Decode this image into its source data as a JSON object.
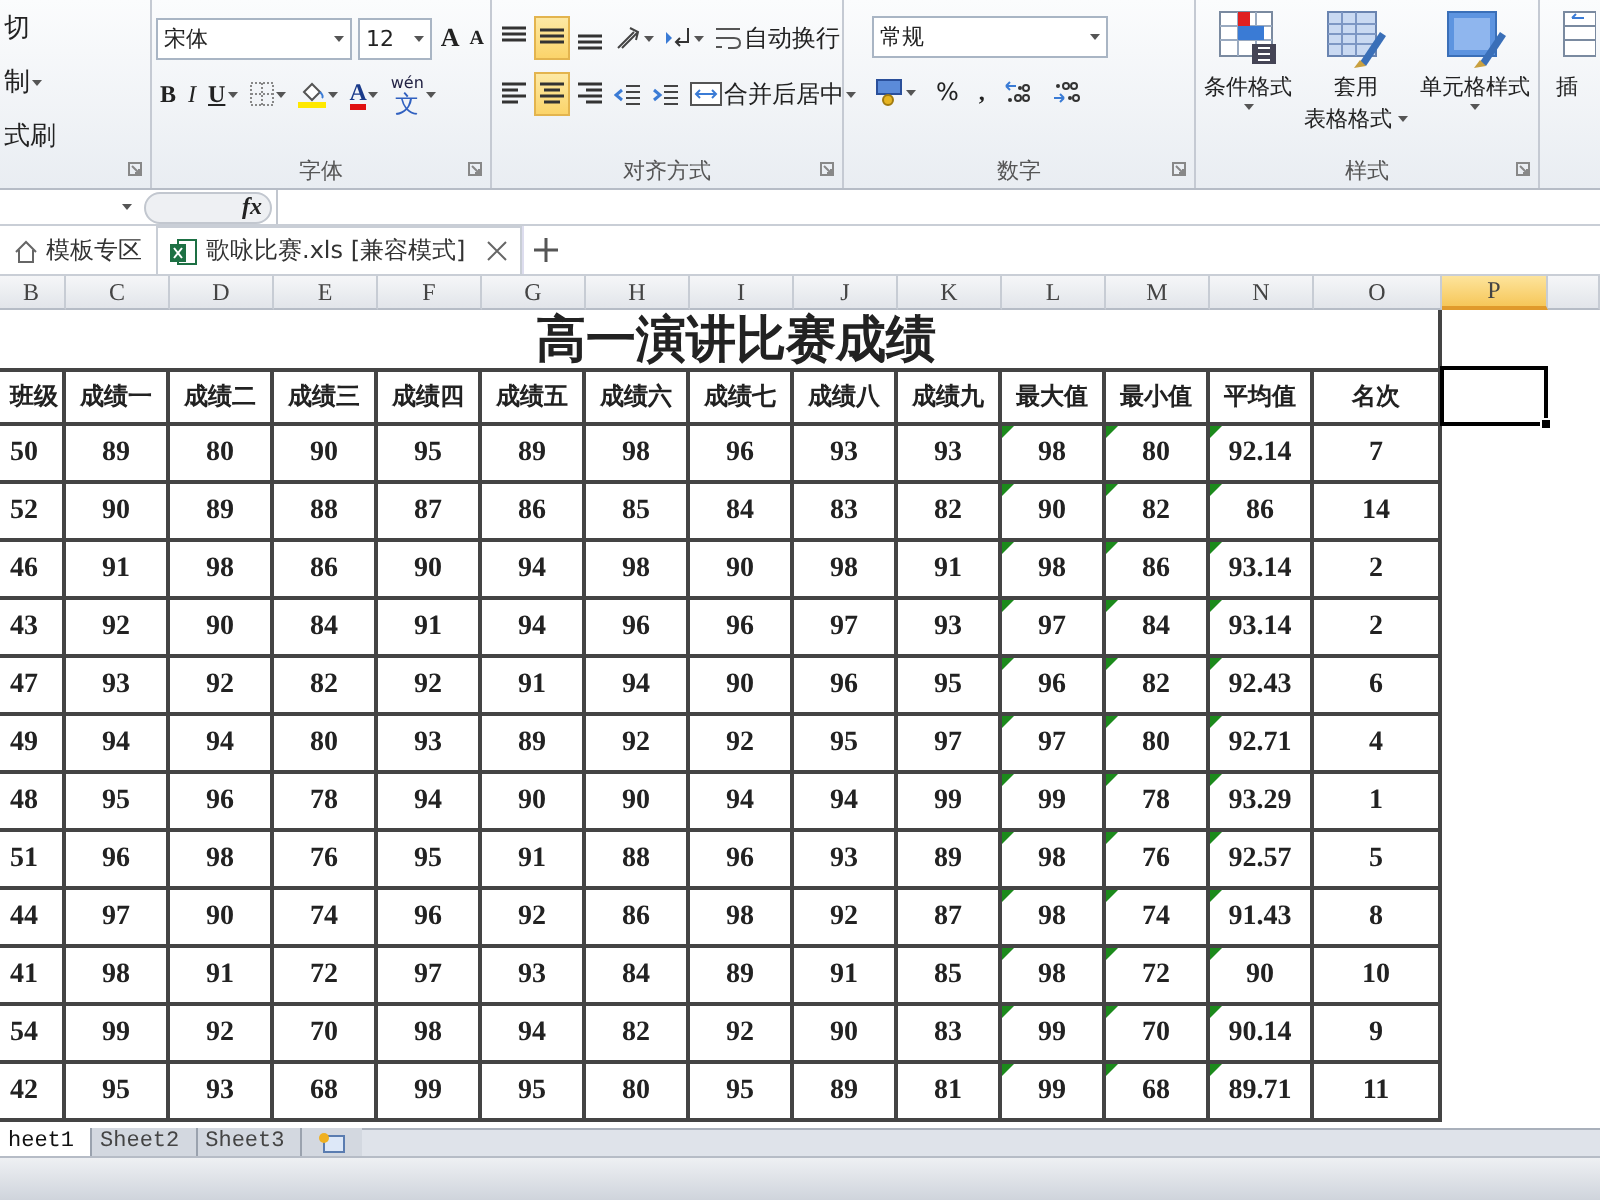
{
  "ribbon": {
    "clipboard": {
      "items": [
        {
          "label": "切",
          "dropdown": false
        },
        {
          "label": "制",
          "dropdown": true
        },
        {
          "label": "式刷",
          "dropdown": false
        }
      ]
    },
    "font": {
      "name": "宋体",
      "size": "12",
      "grow": "A",
      "shrink": "A",
      "styles": [
        "B",
        "I",
        "U"
      ],
      "color_letter": "A",
      "phonetic": [
        "wén",
        "文"
      ],
      "label": "字体"
    },
    "alignment": {
      "vertical": [
        {
          "selected": false
        },
        {
          "selected": true
        },
        {
          "selected": false
        }
      ],
      "horizontal": [
        {
          "selected": false
        },
        {
          "selected": true
        },
        {
          "selected": false
        }
      ],
      "wrap": "自动换行",
      "merge": "合并后居中",
      "label": "对齐方式"
    },
    "number": {
      "format": "常规",
      "percent": "%",
      "comma": ",",
      "label": "数字"
    },
    "styles": {
      "buttons": [
        {
          "kind": "conditional",
          "lines": [
            "条件格式"
          ]
        },
        {
          "kind": "table",
          "lines": [
            "套用",
            "表格格式"
          ]
        },
        {
          "kind": "cell",
          "lines": [
            "单元格样式"
          ]
        }
      ],
      "label": "样式"
    },
    "partial": "插"
  },
  "formula_bar": {
    "function_label": "fx"
  },
  "doc_tabs": [
    {
      "kind": "home",
      "label": "模板专区",
      "selected": false
    },
    {
      "kind": "workbook",
      "label": "歌咏比赛.xls  [兼容模式]",
      "selected": true
    }
  ],
  "sheet": {
    "columns": [
      {
        "letter": "B",
        "selected": false,
        "flagged": false
      },
      {
        "letter": "C",
        "selected": false,
        "flagged": false
      },
      {
        "letter": "D",
        "selected": false,
        "flagged": false
      },
      {
        "letter": "E",
        "selected": false,
        "flagged": false
      },
      {
        "letter": "F",
        "selected": false,
        "flagged": false
      },
      {
        "letter": "G",
        "selected": false,
        "flagged": false
      },
      {
        "letter": "H",
        "selected": false,
        "flagged": false
      },
      {
        "letter": "I",
        "selected": false,
        "flagged": false
      },
      {
        "letter": "J",
        "selected": false,
        "flagged": false
      },
      {
        "letter": "K",
        "selected": false,
        "flagged": false
      },
      {
        "letter": "L",
        "selected": false,
        "flagged": true
      },
      {
        "letter": "M",
        "selected": false,
        "flagged": true
      },
      {
        "letter": "N",
        "selected": false,
        "flagged": true
      },
      {
        "letter": "O",
        "selected": false,
        "flagged": false
      },
      {
        "letter": "P",
        "selected": true,
        "flagged": false
      }
    ],
    "title": "高一演讲比赛成绩",
    "header": [
      "班级",
      "成绩一",
      "成绩二",
      "成绩三",
      "成绩四",
      "成绩五",
      "成绩六",
      "成绩七",
      "成绩八",
      "成绩九",
      "最大值",
      "最小值",
      "平均值",
      "名次"
    ],
    "rows": [
      [
        "50",
        "89",
        "80",
        "90",
        "95",
        "89",
        "98",
        "96",
        "93",
        "93",
        "98",
        "80",
        "92.14",
        "7"
      ],
      [
        "52",
        "90",
        "89",
        "88",
        "87",
        "86",
        "85",
        "84",
        "83",
        "82",
        "90",
        "82",
        "86",
        "14"
      ],
      [
        "46",
        "91",
        "98",
        "86",
        "90",
        "94",
        "98",
        "90",
        "98",
        "91",
        "98",
        "86",
        "93.14",
        "2"
      ],
      [
        "43",
        "92",
        "90",
        "84",
        "91",
        "94",
        "96",
        "96",
        "97",
        "93",
        "97",
        "84",
        "93.14",
        "2"
      ],
      [
        "47",
        "93",
        "92",
        "82",
        "92",
        "91",
        "94",
        "90",
        "96",
        "95",
        "96",
        "82",
        "92.43",
        "6"
      ],
      [
        "49",
        "94",
        "94",
        "80",
        "93",
        "89",
        "92",
        "92",
        "95",
        "97",
        "97",
        "80",
        "92.71",
        "4"
      ],
      [
        "48",
        "95",
        "96",
        "78",
        "94",
        "90",
        "90",
        "94",
        "94",
        "99",
        "99",
        "78",
        "93.29",
        "1"
      ],
      [
        "51",
        "96",
        "98",
        "76",
        "95",
        "91",
        "88",
        "96",
        "93",
        "89",
        "98",
        "76",
        "92.57",
        "5"
      ],
      [
        "44",
        "97",
        "90",
        "74",
        "96",
        "92",
        "86",
        "98",
        "92",
        "87",
        "98",
        "74",
        "91.43",
        "8"
      ],
      [
        "41",
        "98",
        "91",
        "72",
        "97",
        "93",
        "84",
        "89",
        "91",
        "85",
        "98",
        "72",
        "90",
        "10"
      ],
      [
        "54",
        "99",
        "92",
        "70",
        "98",
        "94",
        "82",
        "92",
        "90",
        "83",
        "99",
        "70",
        "90.14",
        "9"
      ],
      [
        "42",
        "95",
        "93",
        "68",
        "99",
        "95",
        "80",
        "95",
        "89",
        "81",
        "99",
        "68",
        "89.71",
        "11"
      ]
    ]
  },
  "sheet_tabs": [
    {
      "label": "heet1",
      "selected": true
    },
    {
      "label": "Sheet2",
      "selected": false
    },
    {
      "label": "Sheet3",
      "selected": false
    }
  ]
}
